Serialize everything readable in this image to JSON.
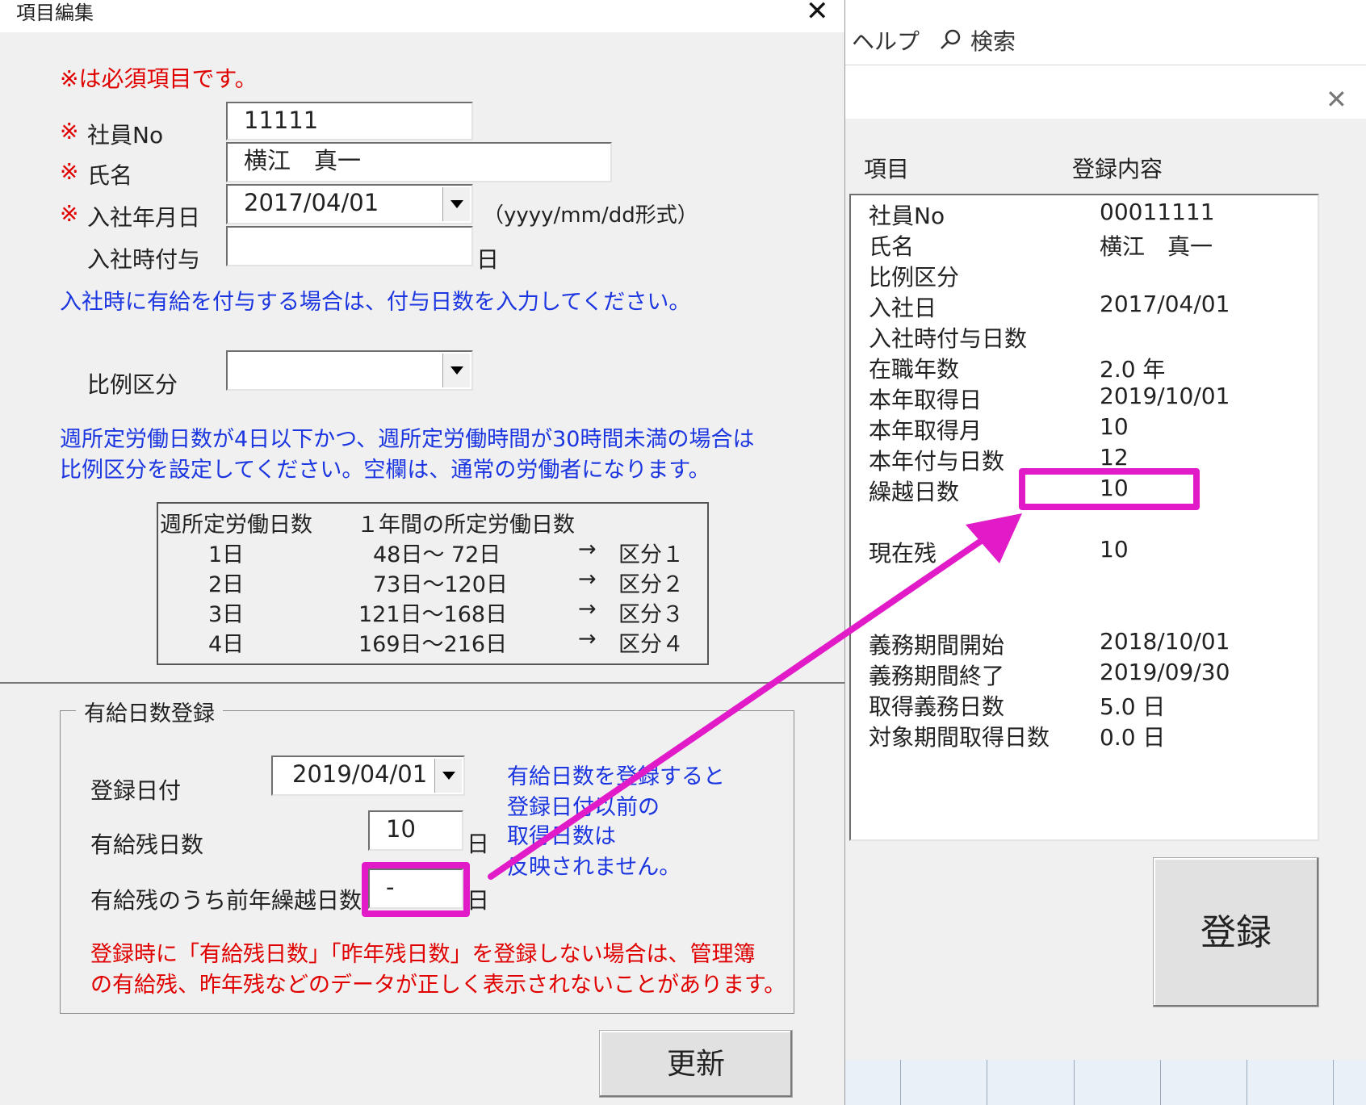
{
  "background": {
    "ribbon_help": "ヘルプ",
    "ribbon_search": "検索"
  },
  "left_dialog": {
    "title": "項目編集",
    "required_note": "※は必須項目です。",
    "required_mark": "※",
    "employee_no_label": "社員No",
    "employee_no_value": "11111",
    "name_label": "氏名",
    "name_value": "横江　真一",
    "hire_date_label": "入社年月日",
    "hire_date_value": "2017/04/01",
    "hire_date_format": "（yyyy/mm/dd形式）",
    "grant_on_hire_label": "入社時付与",
    "grant_on_hire_value": "",
    "day_unit": "日",
    "grant_note": "入社時に有給を付与する場合は、付与日数を入力してください。",
    "ratio_label": "比例区分",
    "ratio_value": "",
    "ratio_note_line1": "週所定労働日数が4日以下かつ、週所定労働時間が30時間未満の場合は",
    "ratio_note_line2": "比例区分を設定してください。空欄は、通常の労働者になります。",
    "ratio_table": {
      "header": [
        "週所定労働日数",
        "１年間の所定労働日数"
      ],
      "rows": [
        [
          "1日",
          "48日～  72日",
          "→",
          "区分１"
        ],
        [
          "2日",
          "73日～120日",
          "→",
          "区分２"
        ],
        [
          "3日",
          "121日～168日",
          "→",
          "区分３"
        ],
        [
          "4日",
          "169日～216日",
          "→",
          "区分４"
        ]
      ]
    },
    "frame": {
      "title": "有給日数登録",
      "reg_date_label": "登録日付",
      "reg_date_value": "2019/04/01",
      "remaining_label": "有給残日数",
      "remaining_value": "10",
      "carryover_label": "有給残のうち前年繰越日数",
      "carryover_value": "-",
      "info_line1": "有給日数を登録すると",
      "info_line2": "登録日付以前の",
      "info_line3": "取得日数は",
      "info_line4": "反映されません。",
      "warning_line1": "登録時に「有給残日数」「昨年残日数」を登録しない場合は、管理簿",
      "warning_line2": "の有給残、昨年残などのデータが正しく表示されないことがあります。"
    },
    "update_button": "更新"
  },
  "right_dialog": {
    "col_item": "項目",
    "col_content": "登録内容",
    "rows": [
      {
        "label": "社員No",
        "value": "00011111"
      },
      {
        "label": "氏名",
        "value": "横江　真一"
      },
      {
        "label": "比例区分",
        "value": ""
      },
      {
        "label": "入社日",
        "value": "2017/04/01"
      },
      {
        "label": "入社時付与日数",
        "value": ""
      },
      {
        "label": "在職年数",
        "value": "2.0 年"
      },
      {
        "label": "本年取得日",
        "value": "2019/10/01"
      },
      {
        "label": "本年取得月",
        "value": "10"
      },
      {
        "label": "本年付与日数",
        "value": "12"
      },
      {
        "label": "繰越日数",
        "value": "10"
      },
      {
        "label": "現在残",
        "value": "10"
      },
      {
        "label": "義務期間開始",
        "value": "2018/10/01"
      },
      {
        "label": "義務期間終了",
        "value": "2019/09/30"
      },
      {
        "label": "取得義務日数",
        "value": "5.0 日"
      },
      {
        "label": "対象期間取得日数",
        "value": "0.0 日"
      }
    ],
    "register_button": "登録"
  },
  "colors": {
    "highlight": "#e21bc9",
    "required_red": "#e00000",
    "note_blue": "#1b36e0",
    "dialog_bg": "#f0f0f0"
  }
}
